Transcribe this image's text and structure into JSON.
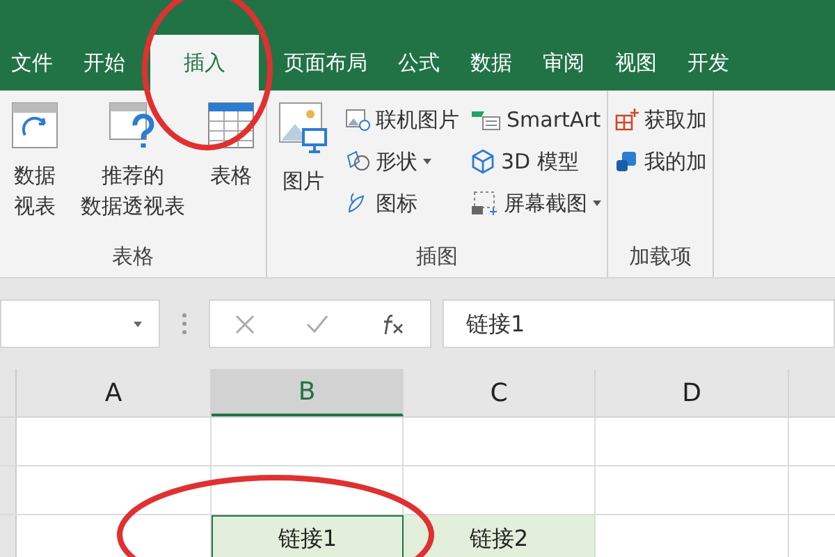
{
  "tabs": [
    {
      "label": "文件",
      "selected": false
    },
    {
      "label": "开始",
      "selected": false
    },
    {
      "label": "插入",
      "selected": true
    },
    {
      "label": "页面布局",
      "selected": false
    },
    {
      "label": "公式",
      "selected": false
    },
    {
      "label": "数据",
      "selected": false
    },
    {
      "label": "审阅",
      "selected": false
    },
    {
      "label": "视图",
      "selected": false
    },
    {
      "label": "开发",
      "selected": false
    }
  ],
  "ribbon": {
    "groups": [
      {
        "label": "表格",
        "items": [
          {
            "kind": "big",
            "lines": [
              "数据",
              "视表"
            ]
          },
          {
            "kind": "big",
            "lines": [
              "推荐的",
              "数据透视表"
            ]
          },
          {
            "kind": "big",
            "lines": [
              "表格"
            ]
          }
        ]
      },
      {
        "label": "插图",
        "items": [
          {
            "kind": "big",
            "lines": [
              "图片"
            ]
          },
          {
            "kind": "column",
            "entries": [
              {
                "label": "联机图片",
                "dropdown": false
              },
              {
                "label": "形状",
                "dropdown": true
              },
              {
                "label": "图标",
                "dropdown": false
              }
            ]
          },
          {
            "kind": "column",
            "entries": [
              {
                "label": "SmartArt",
                "dropdown": false
              },
              {
                "label": "3D 模型",
                "dropdown": false
              },
              {
                "label": "屏幕截图",
                "dropdown": true
              }
            ]
          }
        ]
      },
      {
        "label": "加载项",
        "items": [
          {
            "kind": "column",
            "entries": [
              {
                "label": "获取加",
                "dropdown": false
              },
              {
                "label": "我的加",
                "dropdown": false
              }
            ]
          }
        ]
      }
    ]
  },
  "formula_bar": {
    "value": "链接1"
  },
  "columns": [
    {
      "label": "A",
      "selected": false
    },
    {
      "label": "B",
      "selected": true
    },
    {
      "label": "C",
      "selected": false
    },
    {
      "label": "D",
      "selected": false
    }
  ],
  "rows": [
    {
      "cells": [
        "",
        "",
        "",
        ""
      ]
    },
    {
      "cells": [
        "",
        "",
        "",
        ""
      ]
    },
    {
      "cells": [
        "",
        "链接1",
        "链接2",
        ""
      ],
      "filled": [
        false,
        true,
        true,
        false
      ],
      "selected": [
        false,
        true,
        false,
        false
      ]
    }
  ]
}
